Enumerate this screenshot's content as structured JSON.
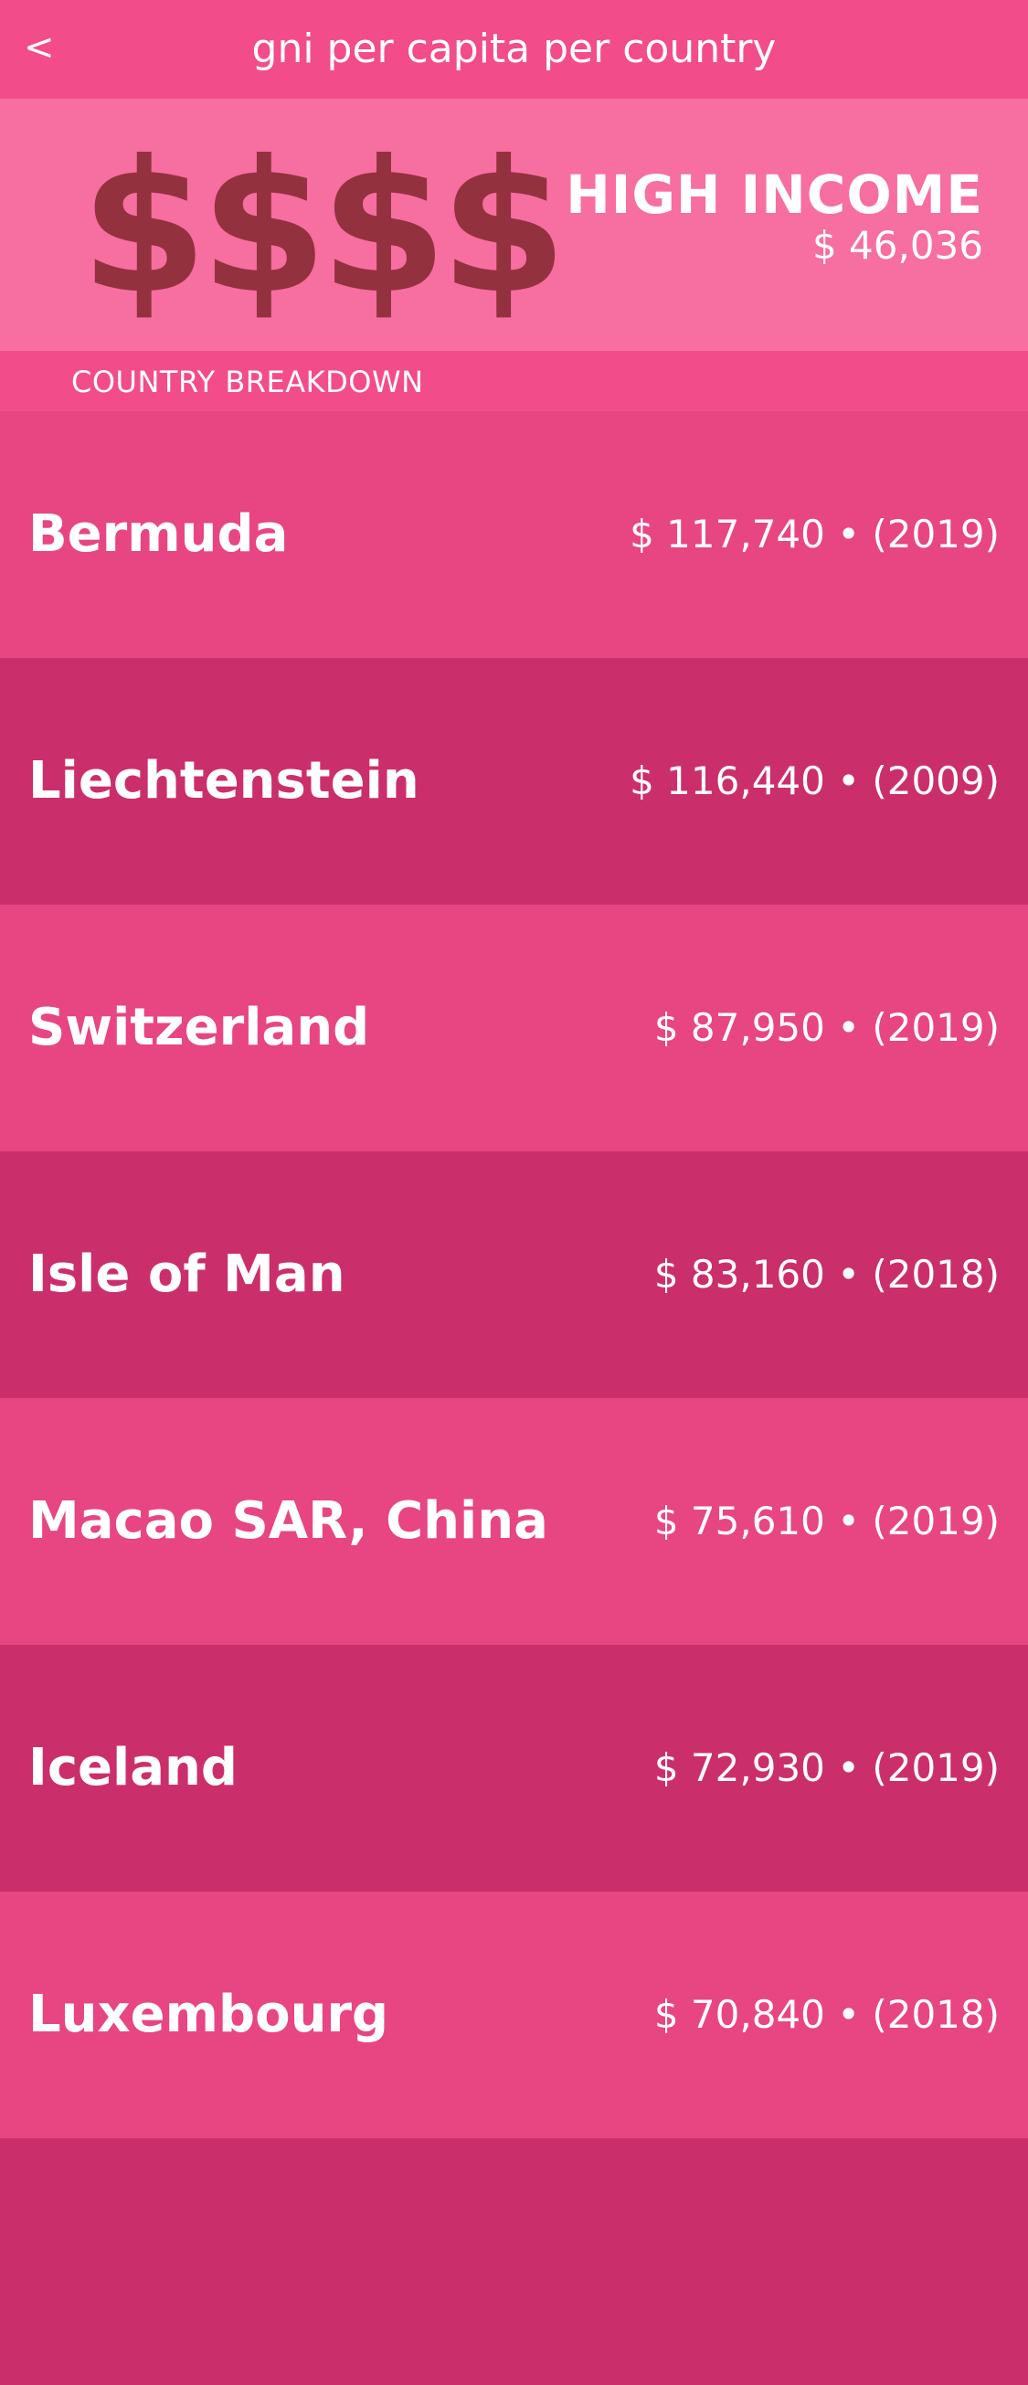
{
  "nav": {
    "back_label": "<",
    "title": "gni per capita per country"
  },
  "header": {
    "icon_text": "$$$$",
    "icon_name": "dollar-signs-icon",
    "tier_title": "HIGH INCOME",
    "tier_value": "$ 46,036"
  },
  "section": {
    "label": "COUNTRY BREAKDOWN"
  },
  "countries": [
    {
      "name": "Bermuda",
      "value": "$ 117,740  •  (2019)"
    },
    {
      "name": "Liechtenstein",
      "value": "$ 116,440  •  (2009)"
    },
    {
      "name": "Switzerland",
      "value": "$ 87,950  •  (2019)"
    },
    {
      "name": "Isle of Man",
      "value": "$ 83,160  •  (2018)"
    },
    {
      "name": "Macao SAR, China",
      "value": "$ 75,610  •  (2019)"
    },
    {
      "name": "Iceland",
      "value": "$ 72,930  •  (2019)"
    },
    {
      "name": "Luxembourg",
      "value": "$ 70,840  •  (2018)"
    }
  ],
  "colors": {
    "nav_bg": "#f34c8a",
    "header_bg": "#f76ea0",
    "icon_color": "#93313f",
    "row_light": "#e84583",
    "row_dark": "#cb2f6b"
  }
}
